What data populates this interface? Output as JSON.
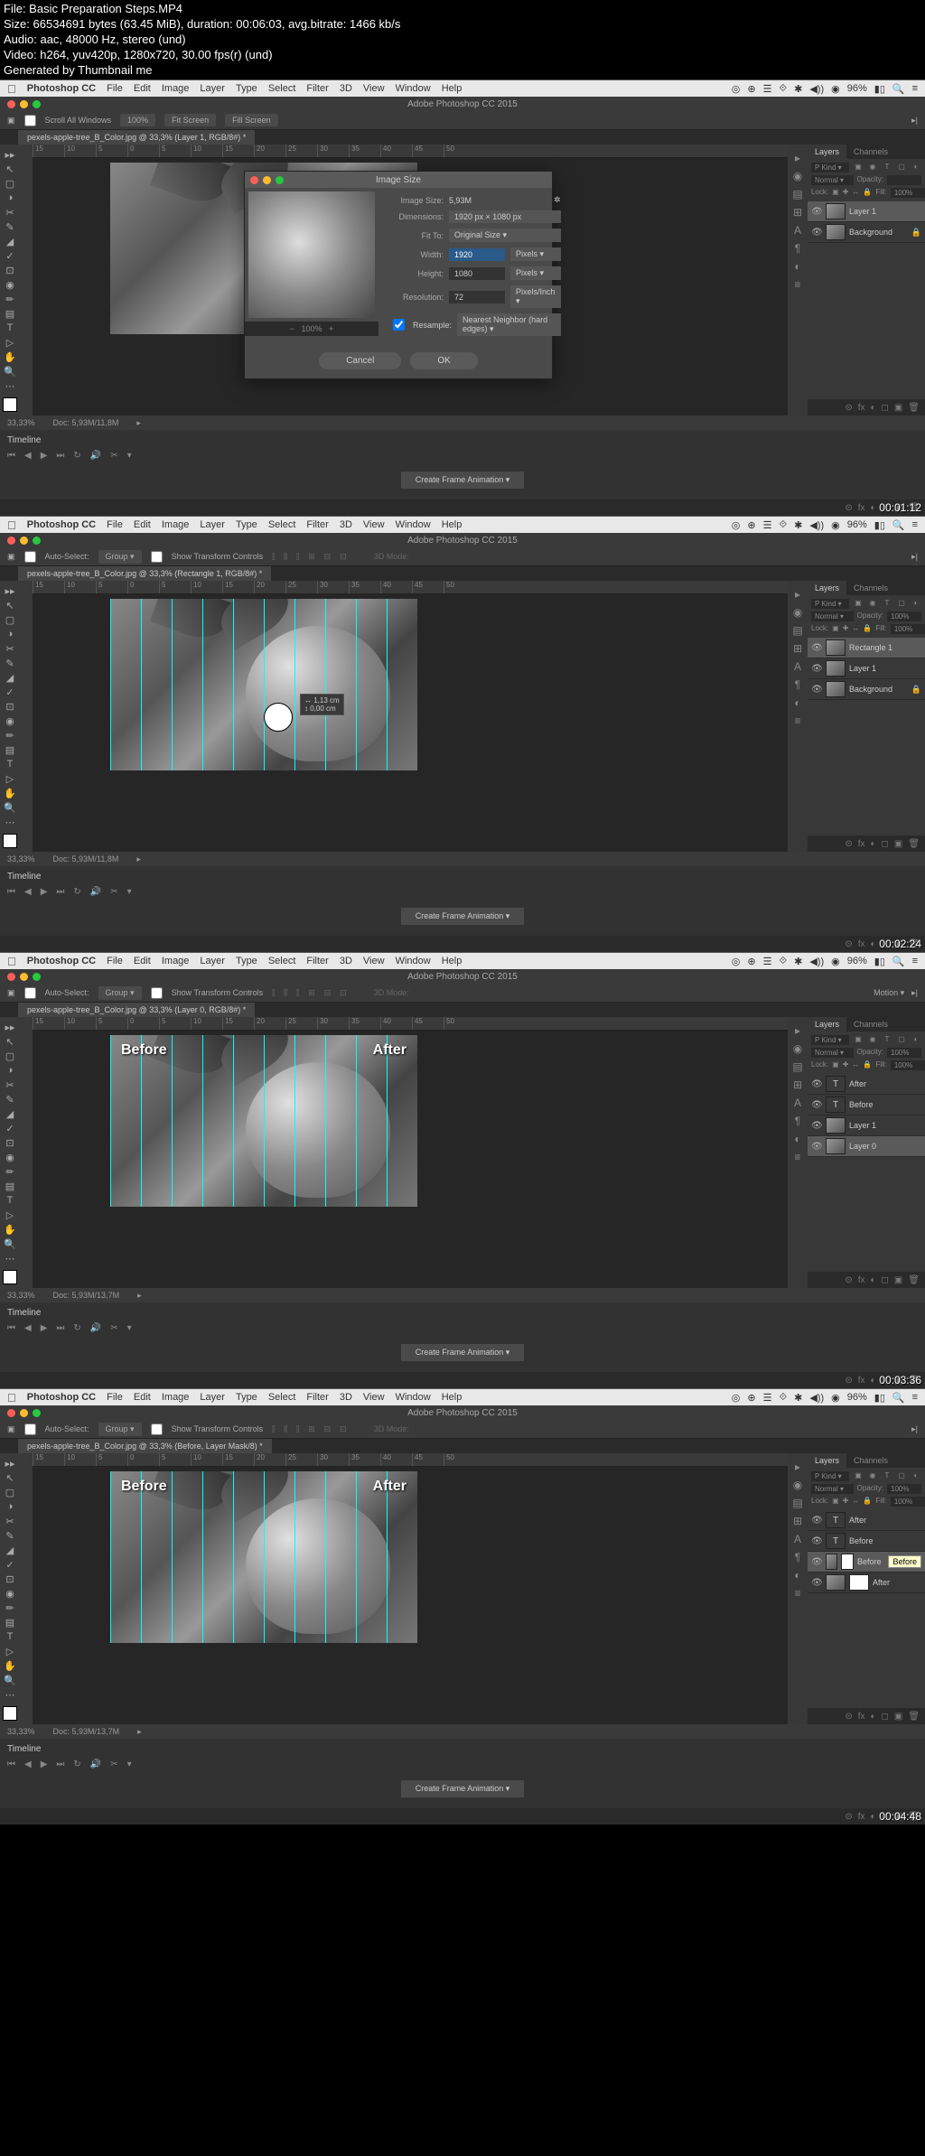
{
  "header": {
    "line1": "File: Basic Preparation Steps.MP4",
    "line2": "Size: 66534691 bytes (63.45 MiB), duration: 00:06:03, avg.bitrate: 1466 kb/s",
    "line3": "Audio: aac, 48000 Hz, stereo (und)",
    "line4": "Video: h264, yuv420p, 1280x720, 30.00 fps(r) (und)",
    "line5": "Generated by Thumbnail me"
  },
  "mac": {
    "app": "Photoshop CC",
    "menus": [
      "File",
      "Edit",
      "Image",
      "Layer",
      "Type",
      "Select",
      "Filter",
      "3D",
      "View",
      "Window",
      "Help"
    ],
    "battery": "96%"
  },
  "window_title": "Adobe Photoshop CC 2015",
  "optbar_scroll": {
    "scroll": "Scroll All Windows",
    "pct": "100%",
    "fit": "Fit Screen",
    "fill": "Fill Screen"
  },
  "optbar_move": {
    "auto": "Auto-Select:",
    "group": "Group",
    "show": "Show Transform Controls"
  },
  "ruler_marks": [
    "15",
    "10",
    "5",
    "0",
    "5",
    "10",
    "15",
    "20",
    "25",
    "30",
    "35",
    "40",
    "45",
    "50"
  ],
  "frames": [
    {
      "tab": "pexels-apple-tree_B_Color.jpg @ 33,3% (Layer 1, RGB/8#) *",
      "status_zoom": "33,33%",
      "status_doc": "Doc: 5,93M/11,8M",
      "timeline": "Timeline",
      "create_anim": "Create Frame Animation",
      "layers": [
        {
          "name": "Layer 1",
          "sel": true,
          "type": "img"
        },
        {
          "name": "Background",
          "sel": false,
          "type": "img",
          "locked": true
        }
      ],
      "timestamp": "00:01:12",
      "dialog": {
        "title": "Image Size",
        "image_size_lbl": "Image Size:",
        "image_size": "5,93M",
        "dim_lbl": "Dimensions:",
        "dim": "1920 px × 1080 px",
        "fit_lbl": "Fit To:",
        "fit": "Original Size",
        "w_lbl": "Width:",
        "w": "1920",
        "w_unit": "Pixels",
        "h_lbl": "Height:",
        "h": "1080",
        "h_unit": "Pixels",
        "res_lbl": "Resolution:",
        "res": "72",
        "res_unit": "Pixels/Inch",
        "resample_lbl": "Resample:",
        "resample": "Nearest Neighbor (hard edges)",
        "zoom": "100%",
        "cancel": "Cancel",
        "ok": "OK"
      }
    },
    {
      "tab": "pexels-apple-tree_B_Color.jpg @ 33,3% (Rectangle 1, RGB/8#) *",
      "status_zoom": "33,33%",
      "status_doc": "Doc: 5,93M/11,8M",
      "timeline": "Timeline",
      "create_anim": "Create Frame Animation",
      "layers": [
        {
          "name": "Rectangle 1",
          "sel": true,
          "type": "shape"
        },
        {
          "name": "Layer 1",
          "sel": false,
          "type": "img"
        },
        {
          "name": "Background",
          "sel": false,
          "type": "img",
          "locked": true
        }
      ],
      "timestamp": "00:02:24",
      "cursor": {
        "x": "1,13 cm",
        "y": "0,00 cm"
      },
      "guides": true,
      "blend": "Normal",
      "opacity": "100%",
      "fill": "100%"
    },
    {
      "tab": "pexels-apple-tree_B_Color.jpg @ 33,3% (Layer 0, RGB/8#) *",
      "status_zoom": "33,33%",
      "status_doc": "Doc: 5,93M/13,7M",
      "timeline": "Timeline",
      "create_anim": "Create Frame Animation",
      "layers": [
        {
          "name": "After",
          "sel": false,
          "type": "txt"
        },
        {
          "name": "Before",
          "sel": false,
          "type": "txt"
        },
        {
          "name": "Layer 1",
          "sel": false,
          "type": "img"
        },
        {
          "name": "Layer 0",
          "sel": true,
          "type": "img"
        }
      ],
      "timestamp": "00:03:36",
      "labels": {
        "before": "Before",
        "after": "After"
      },
      "guides": true,
      "blend": "Normal",
      "opacity": "100%",
      "fill": "100%",
      "motion": "Motion"
    },
    {
      "tab": "pexels-apple-tree_B_Color.jpg @ 33,3% (Before, Layer Mask/8) *",
      "status_zoom": "33,33%",
      "status_doc": "Doc: 5,93M/13,7M",
      "timeline": "Timeline",
      "create_anim": "Create Frame Animation",
      "layers": [
        {
          "name": "After",
          "sel": false,
          "type": "txt"
        },
        {
          "name": "Before",
          "sel": false,
          "type": "txt"
        },
        {
          "name": "Before",
          "sel": true,
          "type": "img",
          "mask": true,
          "tooltip": "Before"
        },
        {
          "name": "After",
          "sel": false,
          "type": "img",
          "mask": true
        }
      ],
      "timestamp": "00:04:48",
      "labels": {
        "before": "Before",
        "after": "After"
      },
      "guides": true,
      "blend": "Normal",
      "opacity": "100%",
      "fill": "100%"
    }
  ],
  "panel_tabs": {
    "layers": "Layers",
    "channels": "Channels"
  },
  "layer_filter": "P Kind",
  "lock_lbl": "Lock:",
  "opacity_lbl": "Opacity:",
  "fill_lbl": "Fill:"
}
